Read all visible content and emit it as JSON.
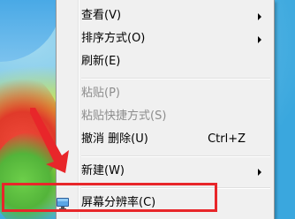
{
  "menu": {
    "items": [
      {
        "label": "查看(V)",
        "submenu": true,
        "disabled": false
      },
      {
        "label": "排序方式(O)",
        "submenu": true,
        "disabled": false
      },
      {
        "label": "刷新(E)",
        "submenu": false,
        "disabled": false
      },
      {
        "label": "粘贴(P)",
        "submenu": false,
        "disabled": true
      },
      {
        "label": "粘贴快捷方式(S)",
        "submenu": false,
        "disabled": true
      },
      {
        "label": "撤消 删除(U)",
        "shortcut": "Ctrl+Z",
        "submenu": false,
        "disabled": false
      },
      {
        "label": "新建(W)",
        "submenu": true,
        "disabled": false
      },
      {
        "label": "屏幕分辨率(C)",
        "submenu": false,
        "disabled": false,
        "icon": "monitor-icon"
      }
    ]
  },
  "annotation": {
    "color": "#e8262a",
    "pointer_icon": "red-arrow-icon",
    "highlighted_item": "屏幕分辨率(C)"
  }
}
